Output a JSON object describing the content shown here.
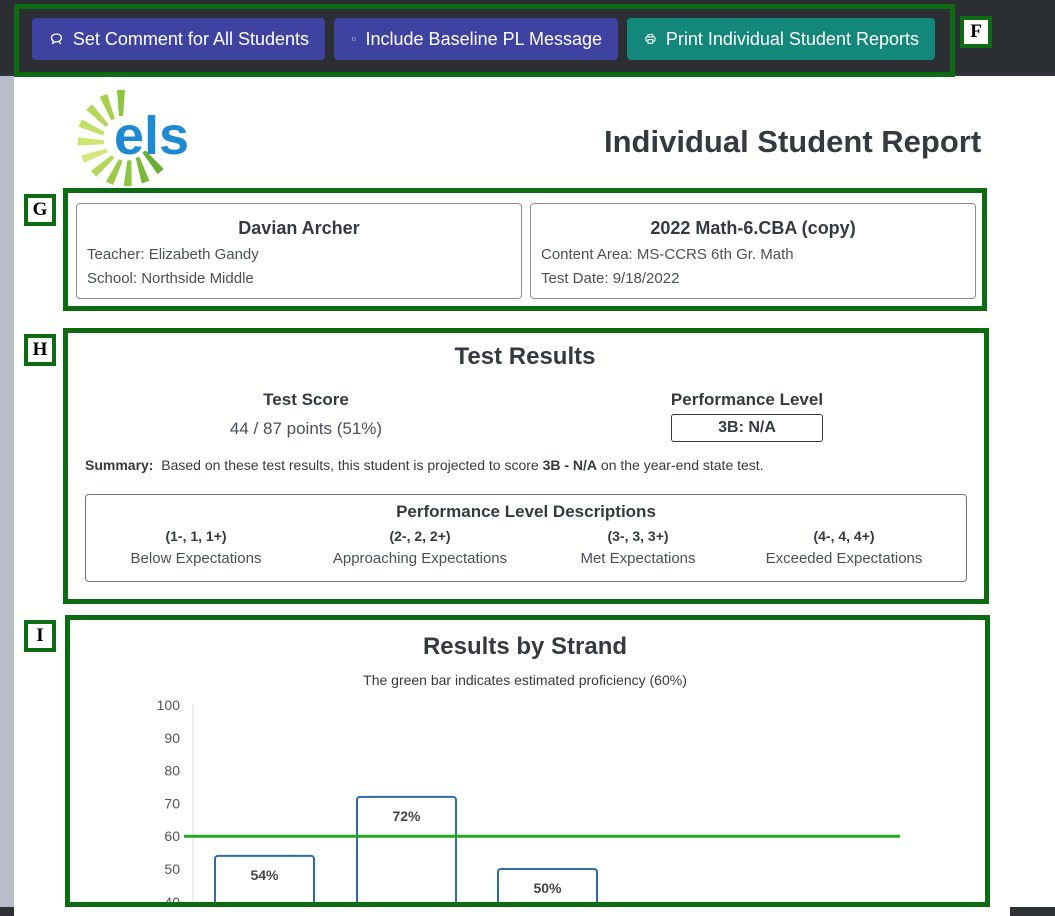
{
  "toolbar": {
    "set_comment_label": "Set Comment for All Students",
    "baseline_label": "Include Baseline PL Message",
    "print_label": "Print Individual Student Reports"
  },
  "logo": {
    "text": "els"
  },
  "report": {
    "title": "Individual Student Report",
    "student": {
      "name": "Davian Archer",
      "teacher": "Teacher: Elizabeth Gandy",
      "school": "School: Northside Middle"
    },
    "test": {
      "name": "2022 Math-6.CBA (copy)",
      "content_area": "Content Area: MS-CCRS 6th Gr. Math",
      "test_date": "Test Date: 9/18/2022"
    }
  },
  "results": {
    "title": "Test Results",
    "score_label": "Test Score",
    "score_value": "44 / 87 points (51%)",
    "level_label": "Performance Level",
    "level_value": "3B: N/A",
    "summary_label": "Summary:",
    "summary_pre": "Based on these test results, this student is projected to score",
    "summary_level": "3B - N/A",
    "summary_post": "on the year-end state test."
  },
  "pld": {
    "title": "Performance Level Descriptions",
    "levels": [
      {
        "range": "(1-, 1, 1+)",
        "desc": "Below Expectations"
      },
      {
        "range": "(2-, 2, 2+)",
        "desc": "Approaching Expectations"
      },
      {
        "range": "(3-, 3, 3+)",
        "desc": "Met Expectations"
      },
      {
        "range": "(4-, 4, 4+)",
        "desc": "Exceeded Expectations"
      }
    ]
  },
  "strand": {
    "title": "Results by Strand",
    "subtitle": "The green bar indicates estimated proficiency (60%)"
  },
  "annotations": {
    "f": "F",
    "g": "G",
    "h": "H",
    "i": "I"
  },
  "colors": {
    "btn_blue": "#3e42a0",
    "btn_teal": "#12877a",
    "highlight": "#0d6b12",
    "bar_stroke": "#2e6da4",
    "proficiency_line": "#22aa22"
  },
  "chart_data": {
    "type": "bar",
    "categories": [
      "",
      "",
      ""
    ],
    "values": [
      54,
      72,
      50
    ],
    "data_labels": [
      "54%",
      "72%",
      "50%"
    ],
    "yticks": [
      40,
      50,
      60,
      70,
      80,
      90,
      100
    ],
    "ylim": [
      40,
      100
    ],
    "reference_line": 60,
    "title": "Results by Strand",
    "xlabel": "",
    "ylabel": ""
  }
}
